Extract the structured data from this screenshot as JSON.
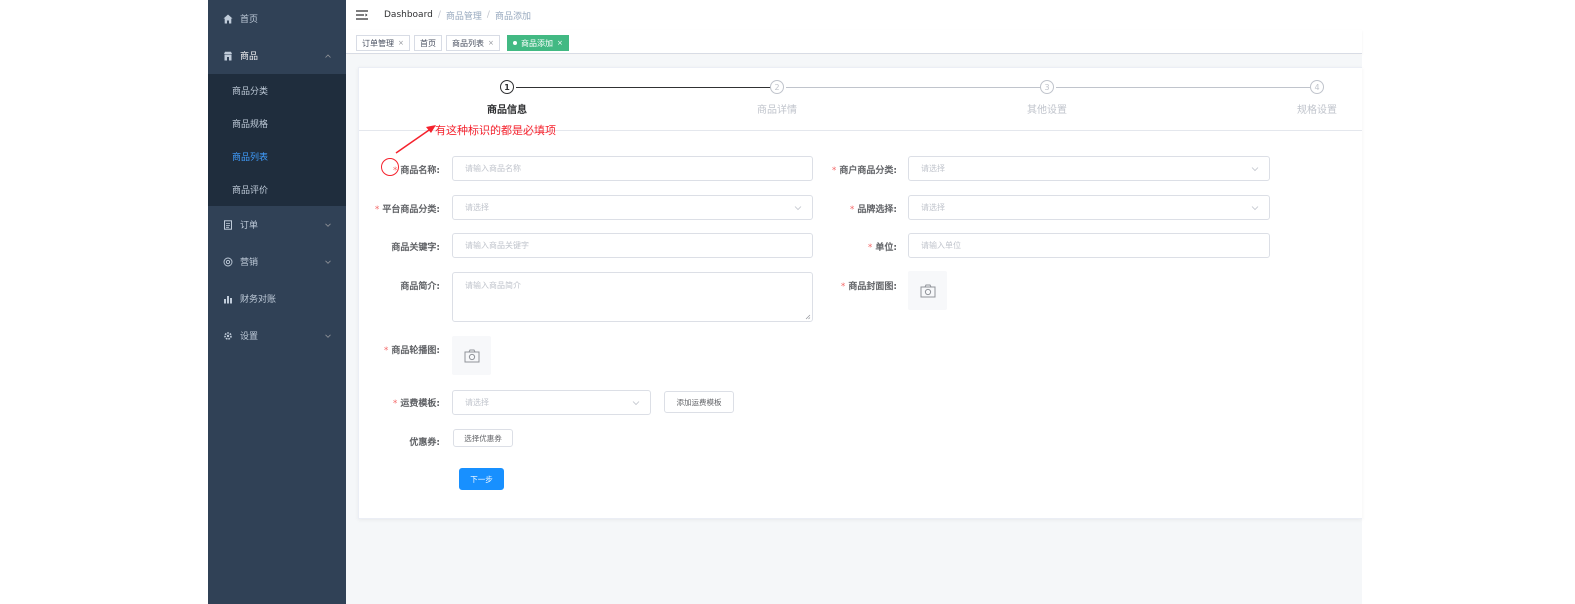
{
  "sidebar": {
    "home": "首页",
    "goods": "商品",
    "goods_sub": [
      "商品分类",
      "商品规格",
      "商品列表",
      "商品评价"
    ],
    "active_sub": "商品列表",
    "order": "订单",
    "marketing": "营销",
    "finance": "财务对账",
    "settings": "设置"
  },
  "navbar": {
    "breadcrumb": [
      "Dashboard",
      "商品管理",
      "商品添加"
    ]
  },
  "tags": [
    {
      "label": "订单管理",
      "closable": true
    },
    {
      "label": "首页",
      "closable": false
    },
    {
      "label": "商品列表",
      "closable": true
    },
    {
      "label": "商品添加",
      "closable": true,
      "active": true
    }
  ],
  "steps": [
    {
      "num": "1",
      "title": "商品信息",
      "active": true
    },
    {
      "num": "2",
      "title": "商品详情",
      "active": false
    },
    {
      "num": "3",
      "title": "其他设置",
      "active": false
    },
    {
      "num": "4",
      "title": "规格设置",
      "active": false
    }
  ],
  "annotation": "有这种标识的都是必填项",
  "form": {
    "name": {
      "label": "商品名称:",
      "placeholder": "请输入商品名称"
    },
    "merchant_category": {
      "label": "商户商品分类:",
      "placeholder": "请选择"
    },
    "platform_category": {
      "label": "平台商品分类:",
      "placeholder": "请选择"
    },
    "brand": {
      "label": "品牌选择:",
      "placeholder": "请选择"
    },
    "keywords": {
      "label": "商品关键字:",
      "placeholder": "请输入商品关键字"
    },
    "unit": {
      "label": "单位:",
      "placeholder": "请输入单位"
    },
    "intro": {
      "label": "商品简介:",
      "placeholder": "请输入商品简介"
    },
    "cover": {
      "label": "商品封面图:"
    },
    "carousel": {
      "label": "商品轮播图:"
    },
    "shipping": {
      "label": "运费模板:",
      "placeholder": "请选择",
      "add_button": "添加运费模板"
    },
    "coupon": {
      "label": "优惠券:",
      "button": "选择优惠券"
    },
    "next_button": "下一步"
  },
  "colors": {
    "sidebar_bg": "#304156",
    "submenu_bg": "#1f2d3d",
    "active_link": "#409eff",
    "active_tag": "#42b983",
    "primary": "#1890ff",
    "required": "#f56c6c",
    "annotation": "#f5222d"
  }
}
